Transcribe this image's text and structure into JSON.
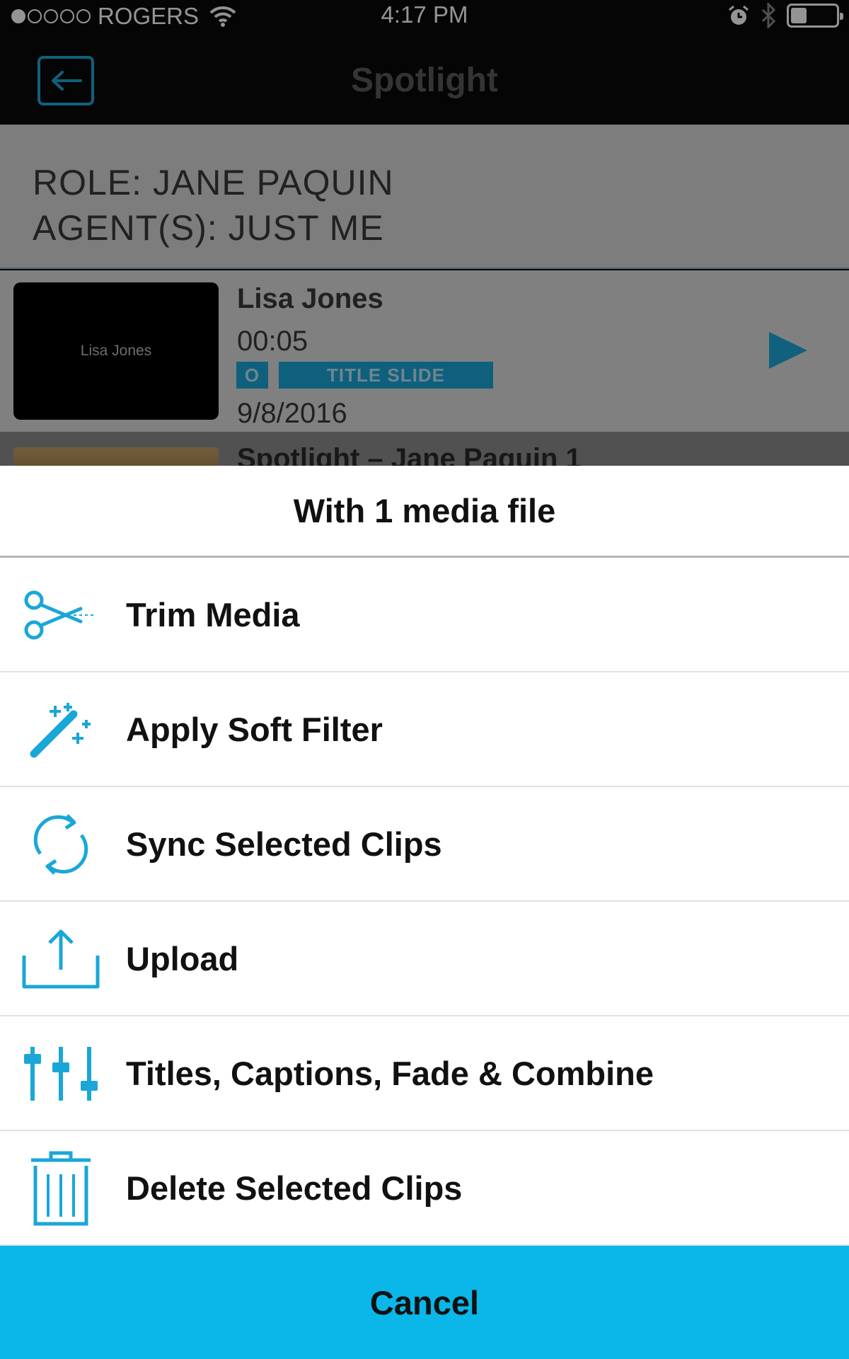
{
  "status_bar": {
    "carrier": "ROGERS",
    "time": "4:17 PM"
  },
  "nav": {
    "title": "Spotlight",
    "back_icon": "arrow-left-icon"
  },
  "role": {
    "role_line": "ROLE: JANE PAQUIN",
    "agent_line": "AGENT(S): JUST ME"
  },
  "clips": [
    {
      "thumbnail_text": "Lisa Jones",
      "title": "Lisa Jones",
      "duration": "00:05",
      "tag_o": "O",
      "tag_type": "TITLE SLIDE",
      "date": "9/8/2016"
    },
    {
      "title": "Spotlight – Jane Paquin 1"
    }
  ],
  "sheet": {
    "header": "With 1 media file",
    "items": [
      {
        "label": "Trim Media",
        "icon": "scissors-icon"
      },
      {
        "label": "Apply Soft Filter",
        "icon": "magic-wand-icon"
      },
      {
        "label": "Sync Selected Clips",
        "icon": "sync-icon"
      },
      {
        "label": "Upload",
        "icon": "upload-icon"
      },
      {
        "label": "Titles, Captions, Fade & Combine",
        "icon": "sliders-icon"
      },
      {
        "label": "Delete Selected Clips",
        "icon": "trash-icon"
      }
    ],
    "cancel": "Cancel"
  },
  "colors": {
    "accent": "#0bb6e8",
    "icon_blue": "#1aa7d8"
  }
}
